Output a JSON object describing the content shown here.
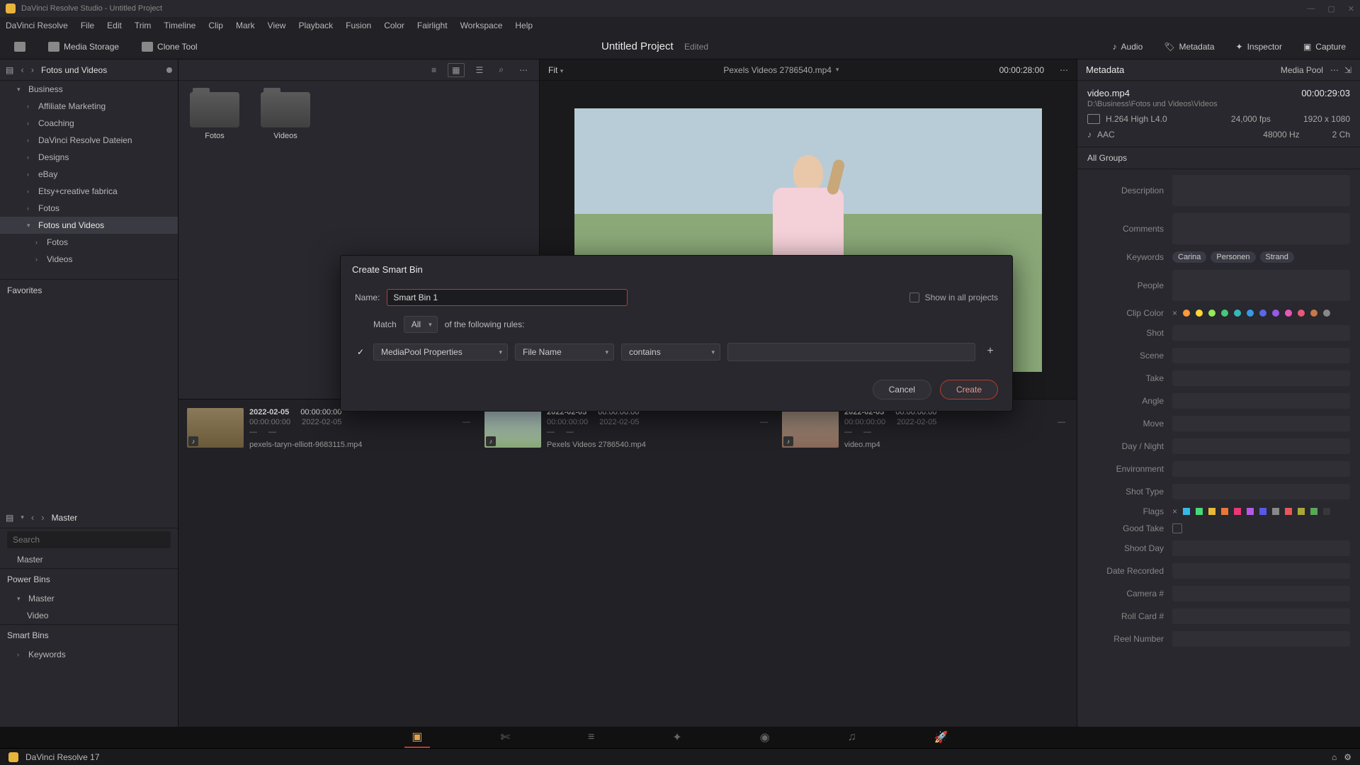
{
  "titlebar": {
    "text": "DaVinci Resolve Studio - Untitled Project"
  },
  "menu": [
    "DaVinci Resolve",
    "File",
    "Edit",
    "Trim",
    "Timeline",
    "Clip",
    "Mark",
    "View",
    "Playback",
    "Fusion",
    "Color",
    "Fairlight",
    "Workspace",
    "Help"
  ],
  "toolbar": {
    "media_storage": "Media Storage",
    "clone_tool": "Clone Tool",
    "project_title": "Untitled Project",
    "project_status": "Edited",
    "audio": "Audio",
    "metadata": "Metadata",
    "inspector": "Inspector",
    "capture": "Capture"
  },
  "left": {
    "breadcrumb": "Fotos und Videos",
    "tree": [
      {
        "label": "Business",
        "depth": 0,
        "expanded": true
      },
      {
        "label": "Affiliate Marketing",
        "depth": 1
      },
      {
        "label": "Coaching",
        "depth": 1
      },
      {
        "label": "DaVinci Resolve Dateien",
        "depth": 1
      },
      {
        "label": "Designs",
        "depth": 1
      },
      {
        "label": "eBay",
        "depth": 1
      },
      {
        "label": "Etsy+creative fabrica",
        "depth": 1
      },
      {
        "label": "Fotos",
        "depth": 1
      },
      {
        "label": "Fotos und Videos",
        "depth": 1,
        "selected": true,
        "expanded": true
      },
      {
        "label": "Fotos",
        "depth": 2
      },
      {
        "label": "Videos",
        "depth": 2
      }
    ],
    "favorites": "Favorites",
    "master": "Master",
    "search_placeholder": "Search",
    "master_bin": "Master",
    "power_bins": "Power Bins",
    "power_master": "Master",
    "power_video": "Video",
    "smart_bins": "Smart Bins",
    "keywords": "Keywords"
  },
  "browser": {
    "folders": [
      "Fotos",
      "Videos"
    ],
    "fit": "Fit"
  },
  "viewer": {
    "clip_name": "Pexels Videos 2786540.mp4",
    "timecode": "00:00:28:00"
  },
  "clips": [
    {
      "date": "2022-02-05",
      "tc": "00:00:00:00",
      "tc2": "00:00:00:00",
      "date2": "2022-02-05",
      "filename": "pexels-taryn-elliott-9683115.mp4",
      "thumb": "p1"
    },
    {
      "date": "2022-02-05",
      "tc": "00:00:00:00",
      "tc2": "00:00:00:00",
      "date2": "2022-02-05",
      "filename": "Pexels Videos 2786540.mp4",
      "thumb": "p2"
    },
    {
      "date": "2022-02-05",
      "tc": "00:00:00:00",
      "tc2": "00:00:00:00",
      "date2": "2022-02-05",
      "filename": "video.mp4",
      "thumb": "p3"
    }
  ],
  "metadata": {
    "title": "Metadata",
    "subtitle": "Media Pool",
    "filename": "video.mp4",
    "duration": "00:00:29:03",
    "path": "D:\\Business\\Fotos und Videos\\Videos",
    "video_codec": "H.264 High L4.0",
    "fps": "24,000 fps",
    "resolution": "1920 x 1080",
    "audio_codec": "AAC",
    "sample_rate": "48000 Hz",
    "channels": "2 Ch",
    "groups": "All Groups",
    "keywords": [
      "Carina",
      "Personen",
      "Strand"
    ],
    "fields": [
      "Description",
      "Comments",
      "Keywords",
      "People",
      "Clip Color",
      "Shot",
      "Scene",
      "Take",
      "Angle",
      "Move",
      "Day / Night",
      "Environment",
      "Shot Type",
      "Flags",
      "Good Take",
      "Shoot Day",
      "Date Recorded",
      "Camera #",
      "Roll Card #",
      "Reel Number"
    ],
    "clip_colors": [
      "#ff9838",
      "#ffd838",
      "#98e858",
      "#48c878",
      "#38b8b8",
      "#3898e8",
      "#5868e8",
      "#9858e8",
      "#e858b8",
      "#e85878",
      "#c87848",
      "#888888"
    ],
    "flag_colors": [
      "#38b8e8",
      "#48d878",
      "#e8b838",
      "#e87838",
      "#e83878",
      "#b858e8",
      "#5858e8",
      "#888888",
      "#e85858",
      "#a8a838",
      "#58a858",
      "#383838"
    ]
  },
  "dialog": {
    "title": "Create Smart Bin",
    "name_label": "Name:",
    "name_value": "Smart Bin 1",
    "show_all": "Show in all projects",
    "match": "Match",
    "match_mode": "All",
    "match_suffix": "of the following rules:",
    "rule_prop": "MediaPool Properties",
    "rule_field": "File Name",
    "rule_op": "contains",
    "cancel": "Cancel",
    "create": "Create"
  },
  "statusbar": {
    "app": "DaVinci Resolve 17"
  }
}
